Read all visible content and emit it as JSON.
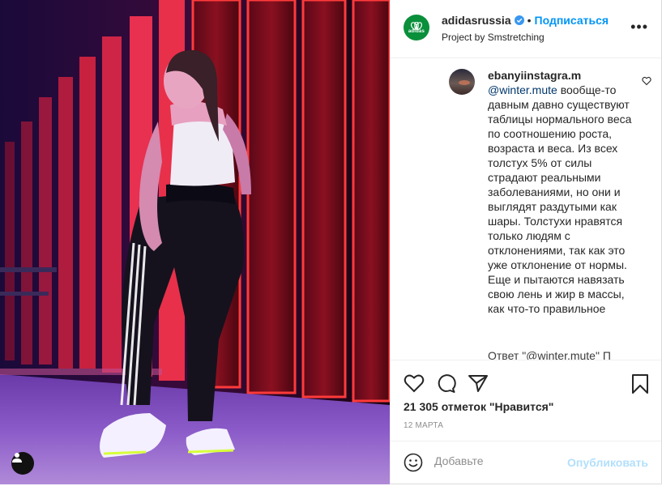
{
  "post": {
    "account": {
      "username": "adidasrussia",
      "verified": true,
      "follow_label": "Подписаться",
      "subtitle": "Project by Smstretching",
      "avatar_text": "adidas"
    },
    "comment": {
      "username": "ebanyiinstagra.m",
      "mention": "@winter.mute",
      "text": " вообще-то давным давно существуют таблицы нормального веса по соотношению роста, возраста и веса. Из всех толстух 5% от силы страдают реальными заболеваниями, но они и выглядят раздутыми как шары. Толстухи нравятся только людям с отклонениями, так как это уже отклонение от нормы. Еще и пытаются навязать свою лень и жир в массы, как что-то правильное"
    },
    "next_comment_preview": "Ответ \"@winter.mute\" П",
    "likes": "21 305 отметок \"Нравится\"",
    "date": "12 МАРТА",
    "comment_box": {
      "placeholder": "Добавьте",
      "publish_label": "Опубликовать"
    }
  },
  "colors": {
    "accent": "#0095f6",
    "brand_green": "#0a8f3b",
    "publish_disabled": "#b2dffc"
  },
  "icons": [
    "verified-icon",
    "more-icon",
    "heart-icon",
    "comment-icon",
    "share-icon",
    "bookmark-icon",
    "emoji-icon",
    "user-tag-icon"
  ]
}
